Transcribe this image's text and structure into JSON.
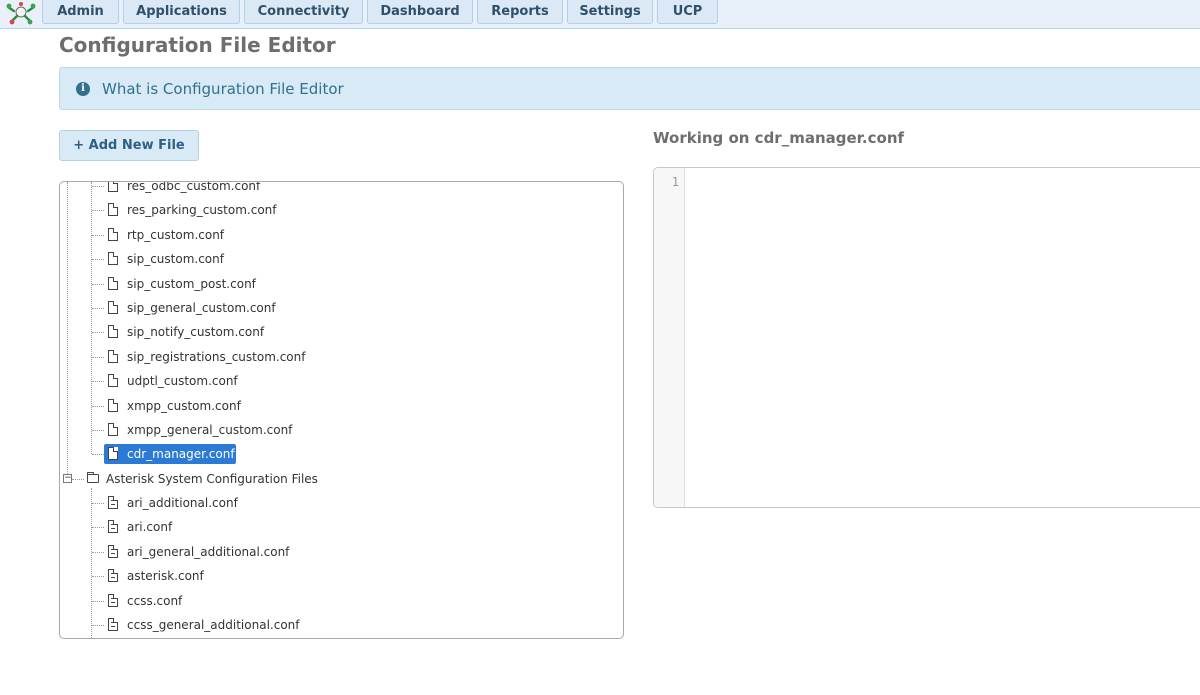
{
  "nav": {
    "tabs": [
      {
        "label": "Admin"
      },
      {
        "label": "Applications"
      },
      {
        "label": "Connectivity"
      },
      {
        "label": "Dashboard"
      },
      {
        "label": "Reports"
      },
      {
        "label": "Settings"
      },
      {
        "label": "UCP"
      }
    ]
  },
  "page": {
    "title": "Configuration File Editor",
    "info_text": "What is Configuration File Editor",
    "add_button": "+ Add New File",
    "working_title": "Working on cdr_manager.conf"
  },
  "tree": {
    "custom_files": [
      "res_odbc_custom.conf",
      "res_parking_custom.conf",
      "rtp_custom.conf",
      "sip_custom.conf",
      "sip_custom_post.conf",
      "sip_general_custom.conf",
      "sip_notify_custom.conf",
      "sip_registrations_custom.conf",
      "udptl_custom.conf",
      "xmpp_custom.conf",
      "xmpp_general_custom.conf",
      "cdr_manager.conf"
    ],
    "selected": "cdr_manager.conf",
    "system_folder": "Asterisk System Configuration Files",
    "toggle_symbol": "−",
    "system_files": [
      "ari_additional.conf",
      "ari.conf",
      "ari_general_additional.conf",
      "asterisk.conf",
      "ccss.conf",
      "ccss_general_additional.conf"
    ]
  },
  "editor": {
    "line_numbers": [
      "1"
    ],
    "content": ""
  },
  "colors": {
    "accent": "#2b7bd6",
    "info_bg": "#d9eaf7",
    "info_text": "#31708f"
  }
}
